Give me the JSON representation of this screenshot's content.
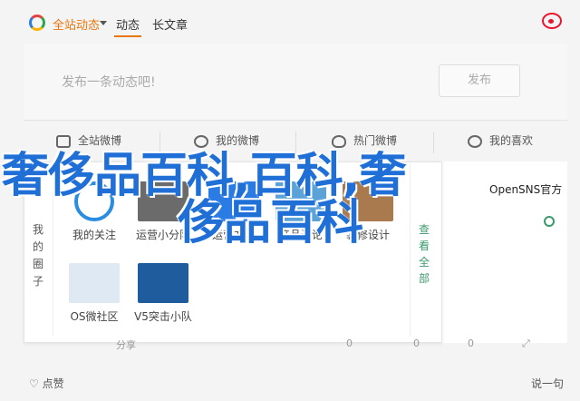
{
  "header": {
    "all_feed": "全站动态",
    "tab_dynamic": "动态",
    "tab_long": "长文章"
  },
  "composer": {
    "placeholder": "发布一条动态吧!",
    "publish": "发布"
  },
  "filters": [
    "全站微博",
    "我的微博",
    "热门微博",
    "我的喜欢"
  ],
  "panel": {
    "side_left": [
      "我",
      "的",
      "圈",
      "子"
    ],
    "side_right": [
      "查",
      "看",
      "全",
      "部"
    ],
    "apps": [
      {
        "label": "我的关注",
        "icon": "icon",
        "color": "#2b8de0"
      },
      {
        "label": "运营小分队",
        "icon": "icon",
        "color": "#6b6b6b"
      },
      {
        "label": "运营方法",
        "icon": "icon",
        "color": "#2a7be4"
      },
      {
        "label": "产品讨论",
        "icon": "icon",
        "color": "#5aa2d8"
      },
      {
        "label": "装修设计",
        "icon": "icon",
        "color": "#a87a4e"
      },
      {
        "label": "OS微社区",
        "icon": "icon",
        "color": "#dfe9f4"
      },
      {
        "label": "V5突击小队",
        "icon": "icon",
        "color": "#1f5c9e"
      }
    ]
  },
  "right": {
    "opensns": "OpenSNS官方"
  },
  "actions": {
    "share": "分享",
    "comments": "0",
    "reposts": "0",
    "likes": "0"
  },
  "footer": {
    "like": "点赞",
    "say": "说一句"
  },
  "overlay": {
    "line1": "奢侈品百科,百科,奢",
    "line2": "侈品百科"
  }
}
